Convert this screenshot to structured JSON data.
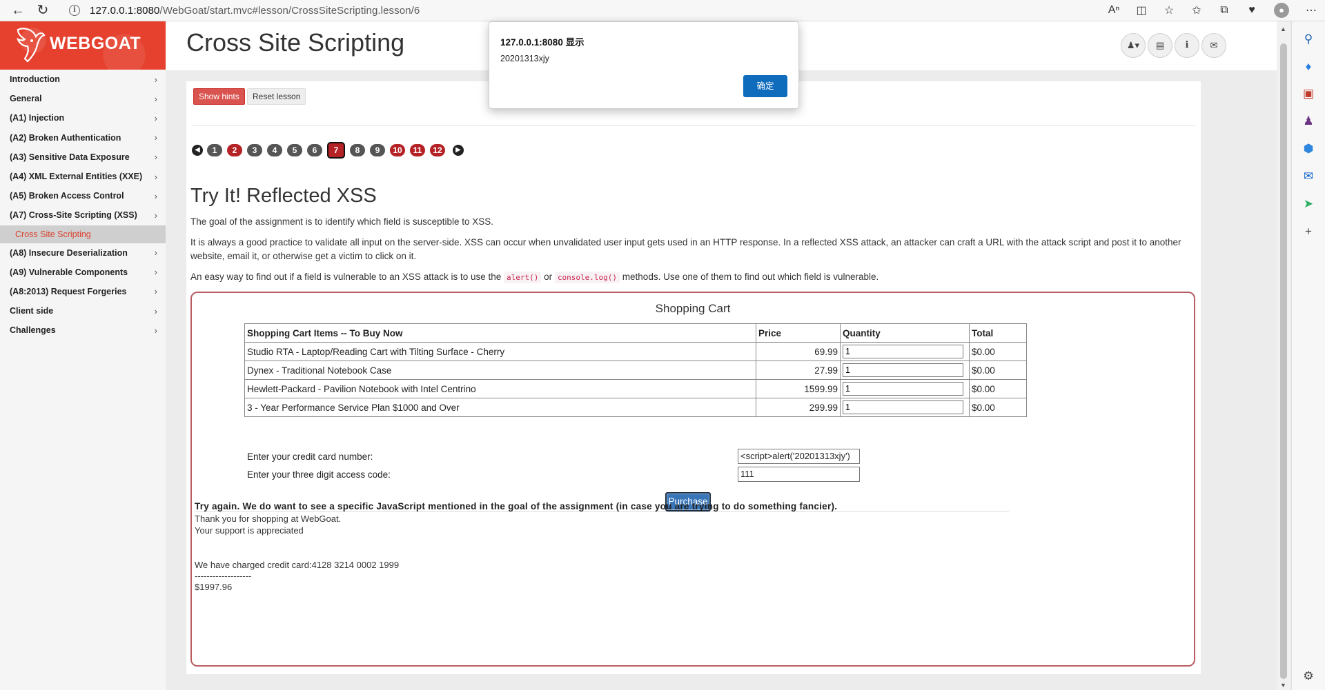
{
  "browser": {
    "url_host": "127.0.0.1:8080",
    "url_path": "/WebGoat/start.mvc#lesson/CrossSiteScripting.lesson/6"
  },
  "brand": {
    "name": "WEBGOAT"
  },
  "menu": {
    "items": [
      {
        "label": "Introduction"
      },
      {
        "label": "General"
      },
      {
        "label": "(A1) Injection"
      },
      {
        "label": "(A2) Broken Authentication"
      },
      {
        "label": "(A3) Sensitive Data Exposure"
      },
      {
        "label": "(A4) XML External Entities (XXE)"
      },
      {
        "label": "(A5) Broken Access Control"
      },
      {
        "label": "(A7) Cross-Site Scripting (XSS)"
      }
    ],
    "active_sub": "Cross Site Scripting",
    "items_after": [
      {
        "label": "(A8) Insecure Deserialization"
      },
      {
        "label": "(A9) Vulnerable Components"
      },
      {
        "label": "(A8:2013) Request Forgeries"
      },
      {
        "label": "Client side"
      },
      {
        "label": "Challenges"
      }
    ]
  },
  "header": {
    "title": "Cross Site Scripting"
  },
  "lesson": {
    "show_hints": "Show hints",
    "reset_lesson": "Reset lesson",
    "pages": [
      "1",
      "2",
      "3",
      "4",
      "5",
      "6",
      "7",
      "8",
      "9",
      "10",
      "11",
      "12"
    ],
    "current_page": "7",
    "section_title": "Try It! Reflected XSS",
    "para1": "The goal of the assignment is to identify which field is susceptible to XSS.",
    "para2": "It is always a good practice to validate all input on the server-side. XSS can occur when unvalidated user input gets used in an HTTP response. In a reflected XSS attack, an attacker can craft a URL with the attack script and post it to another website, email it, or otherwise get a victim to click on it.",
    "para3_a": "An easy way to find out if a field is vulnerable to an XSS attack is to use the",
    "para3_code1": "alert()",
    "para3_or": "or",
    "para3_code2": "console.log()",
    "para3_b": "methods. Use one of them to find out which field is vulnerable."
  },
  "cart": {
    "title": "Shopping Cart",
    "headers": [
      "Shopping Cart Items -- To Buy Now",
      "Price",
      "Quantity",
      "Total"
    ],
    "rows": [
      {
        "item": "Studio RTA - Laptop/Reading Cart with Tilting Surface - Cherry",
        "price": "69.99",
        "qty": "1",
        "total": "$0.00"
      },
      {
        "item": "Dynex - Traditional Notebook Case",
        "price": "27.99",
        "qty": "1",
        "total": "$0.00"
      },
      {
        "item": "Hewlett-Packard - Pavilion Notebook with Intel Centrino",
        "price": "1599.99",
        "qty": "1",
        "total": "$0.00"
      },
      {
        "item": "3 - Year Performance Service Plan $1000 and Over",
        "price": "299.99",
        "qty": "1",
        "total": "$0.00"
      }
    ],
    "credit_label": "Enter your credit card number:",
    "credit_value": "<script>alert('20201313xjy')",
    "access_label": "Enter your three digit access code:",
    "access_value": "111",
    "purchase": "Purchase"
  },
  "result": {
    "feedback": "Try again. We do want to see a specific JavaScript mentioned in the goal of the assignment (in case you are trying to do something fancier).",
    "thanks": "Thank you for shopping at WebGoat.",
    "support": "Your support is appreciated",
    "charged": "We have charged credit card:4128 3214 0002 1999",
    "dashes": "-------------------",
    "amount": "$1997.96"
  },
  "alert": {
    "title": "127.0.0.1:8080 显示",
    "message": "20201313xjy",
    "ok": "确定"
  },
  "colors": {
    "brand": "#e5412e",
    "hint_button": "#d9534f",
    "page_red": "#b52226",
    "page_grey": "#555555",
    "purchase": "#3976b8",
    "alert_ok": "#0f6cbd"
  }
}
